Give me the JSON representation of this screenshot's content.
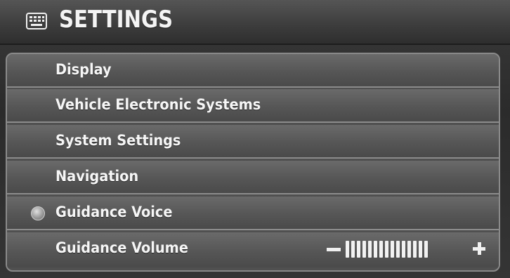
{
  "header": {
    "title": "SETTINGS",
    "icon": "settings-keypad-icon"
  },
  "menu": {
    "items": [
      {
        "label": "Display"
      },
      {
        "label": "Vehicle Electronic Systems"
      },
      {
        "label": "System Settings"
      },
      {
        "label": "Navigation"
      },
      {
        "label": "Guidance Voice",
        "indicator": "on-indicator-icon"
      },
      {
        "label": "Guidance Volume"
      }
    ]
  },
  "guidance_volume": {
    "level": 1.0,
    "bars_total": 15,
    "bars_filled": 15
  },
  "colors": {
    "background": "#2b2b2b",
    "row": "#565656",
    "divider": "#8c8c8c",
    "text": "#f4f4f4"
  }
}
